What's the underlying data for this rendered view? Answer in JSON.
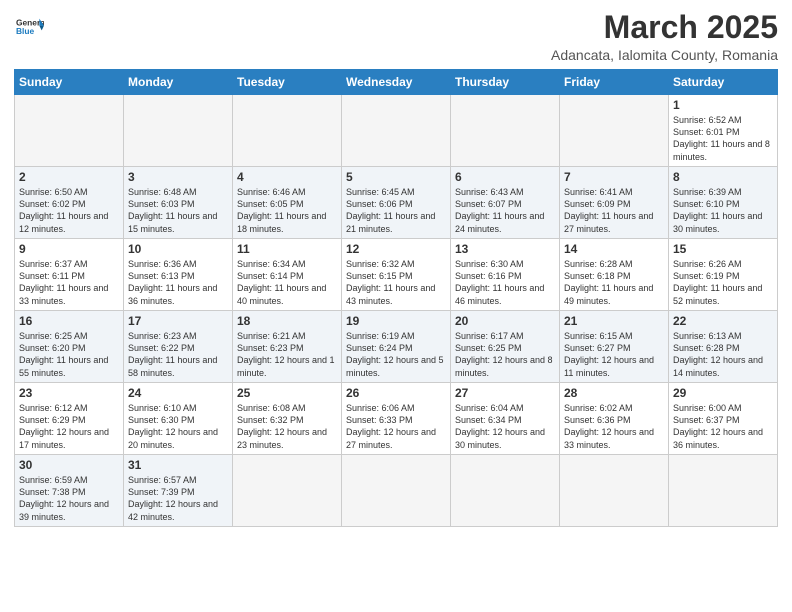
{
  "logo": {
    "text_general": "General",
    "text_blue": "Blue"
  },
  "header": {
    "month_year": "March 2025",
    "location": "Adancata, Ialomita County, Romania"
  },
  "weekdays": [
    "Sunday",
    "Monday",
    "Tuesday",
    "Wednesday",
    "Thursday",
    "Friday",
    "Saturday"
  ],
  "weeks": [
    [
      {
        "day": "",
        "info": ""
      },
      {
        "day": "",
        "info": ""
      },
      {
        "day": "",
        "info": ""
      },
      {
        "day": "",
        "info": ""
      },
      {
        "day": "",
        "info": ""
      },
      {
        "day": "",
        "info": ""
      },
      {
        "day": "1",
        "info": "Sunrise: 6:52 AM\nSunset: 6:01 PM\nDaylight: 11 hours and 8 minutes."
      }
    ],
    [
      {
        "day": "2",
        "info": "Sunrise: 6:50 AM\nSunset: 6:02 PM\nDaylight: 11 hours and 12 minutes."
      },
      {
        "day": "3",
        "info": "Sunrise: 6:48 AM\nSunset: 6:03 PM\nDaylight: 11 hours and 15 minutes."
      },
      {
        "day": "4",
        "info": "Sunrise: 6:46 AM\nSunset: 6:05 PM\nDaylight: 11 hours and 18 minutes."
      },
      {
        "day": "5",
        "info": "Sunrise: 6:45 AM\nSunset: 6:06 PM\nDaylight: 11 hours and 21 minutes."
      },
      {
        "day": "6",
        "info": "Sunrise: 6:43 AM\nSunset: 6:07 PM\nDaylight: 11 hours and 24 minutes."
      },
      {
        "day": "7",
        "info": "Sunrise: 6:41 AM\nSunset: 6:09 PM\nDaylight: 11 hours and 27 minutes."
      },
      {
        "day": "8",
        "info": "Sunrise: 6:39 AM\nSunset: 6:10 PM\nDaylight: 11 hours and 30 minutes."
      }
    ],
    [
      {
        "day": "9",
        "info": "Sunrise: 6:37 AM\nSunset: 6:11 PM\nDaylight: 11 hours and 33 minutes."
      },
      {
        "day": "10",
        "info": "Sunrise: 6:36 AM\nSunset: 6:13 PM\nDaylight: 11 hours and 36 minutes."
      },
      {
        "day": "11",
        "info": "Sunrise: 6:34 AM\nSunset: 6:14 PM\nDaylight: 11 hours and 40 minutes."
      },
      {
        "day": "12",
        "info": "Sunrise: 6:32 AM\nSunset: 6:15 PM\nDaylight: 11 hours and 43 minutes."
      },
      {
        "day": "13",
        "info": "Sunrise: 6:30 AM\nSunset: 6:16 PM\nDaylight: 11 hours and 46 minutes."
      },
      {
        "day": "14",
        "info": "Sunrise: 6:28 AM\nSunset: 6:18 PM\nDaylight: 11 hours and 49 minutes."
      },
      {
        "day": "15",
        "info": "Sunrise: 6:26 AM\nSunset: 6:19 PM\nDaylight: 11 hours and 52 minutes."
      }
    ],
    [
      {
        "day": "16",
        "info": "Sunrise: 6:25 AM\nSunset: 6:20 PM\nDaylight: 11 hours and 55 minutes."
      },
      {
        "day": "17",
        "info": "Sunrise: 6:23 AM\nSunset: 6:22 PM\nDaylight: 11 hours and 58 minutes."
      },
      {
        "day": "18",
        "info": "Sunrise: 6:21 AM\nSunset: 6:23 PM\nDaylight: 12 hours and 1 minute."
      },
      {
        "day": "19",
        "info": "Sunrise: 6:19 AM\nSunset: 6:24 PM\nDaylight: 12 hours and 5 minutes."
      },
      {
        "day": "20",
        "info": "Sunrise: 6:17 AM\nSunset: 6:25 PM\nDaylight: 12 hours and 8 minutes."
      },
      {
        "day": "21",
        "info": "Sunrise: 6:15 AM\nSunset: 6:27 PM\nDaylight: 12 hours and 11 minutes."
      },
      {
        "day": "22",
        "info": "Sunrise: 6:13 AM\nSunset: 6:28 PM\nDaylight: 12 hours and 14 minutes."
      }
    ],
    [
      {
        "day": "23",
        "info": "Sunrise: 6:12 AM\nSunset: 6:29 PM\nDaylight: 12 hours and 17 minutes."
      },
      {
        "day": "24",
        "info": "Sunrise: 6:10 AM\nSunset: 6:30 PM\nDaylight: 12 hours and 20 minutes."
      },
      {
        "day": "25",
        "info": "Sunrise: 6:08 AM\nSunset: 6:32 PM\nDaylight: 12 hours and 23 minutes."
      },
      {
        "day": "26",
        "info": "Sunrise: 6:06 AM\nSunset: 6:33 PM\nDaylight: 12 hours and 27 minutes."
      },
      {
        "day": "27",
        "info": "Sunrise: 6:04 AM\nSunset: 6:34 PM\nDaylight: 12 hours and 30 minutes."
      },
      {
        "day": "28",
        "info": "Sunrise: 6:02 AM\nSunset: 6:36 PM\nDaylight: 12 hours and 33 minutes."
      },
      {
        "day": "29",
        "info": "Sunrise: 6:00 AM\nSunset: 6:37 PM\nDaylight: 12 hours and 36 minutes."
      }
    ],
    [
      {
        "day": "30",
        "info": "Sunrise: 6:59 AM\nSunset: 7:38 PM\nDaylight: 12 hours and 39 minutes."
      },
      {
        "day": "31",
        "info": "Sunrise: 6:57 AM\nSunset: 7:39 PM\nDaylight: 12 hours and 42 minutes."
      },
      {
        "day": "",
        "info": ""
      },
      {
        "day": "",
        "info": ""
      },
      {
        "day": "",
        "info": ""
      },
      {
        "day": "",
        "info": ""
      },
      {
        "day": "",
        "info": ""
      }
    ]
  ]
}
